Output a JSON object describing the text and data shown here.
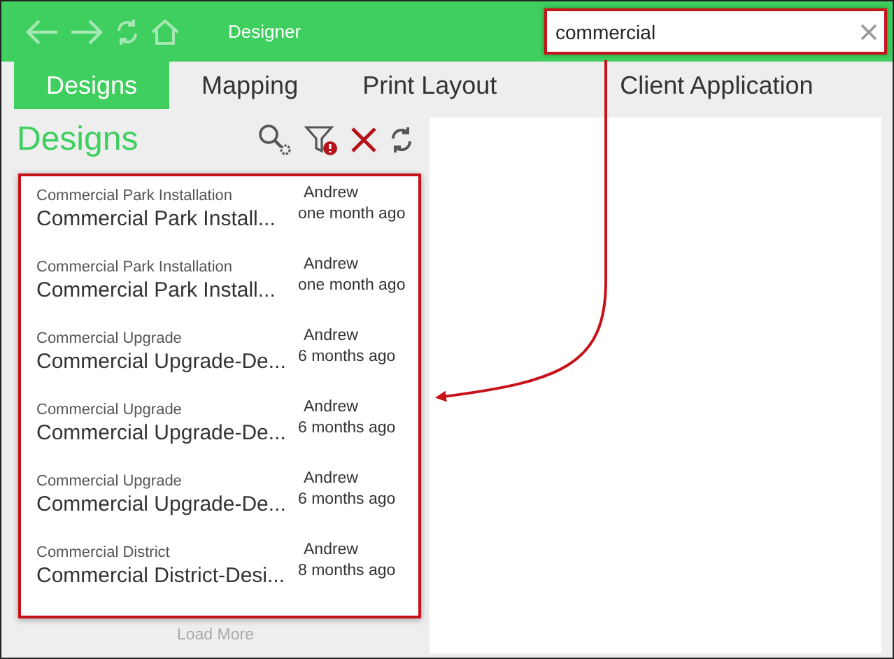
{
  "header": {
    "title": "Designer",
    "search": {
      "value": "commercial"
    }
  },
  "tabs": [
    {
      "label": "Designs",
      "selected": true
    },
    {
      "label": "Mapping",
      "selected": false
    },
    {
      "label": "Print Layout",
      "selected": false
    },
    {
      "label": "Client Application",
      "selected": false
    }
  ],
  "panel": {
    "title": "Designs",
    "designs": [
      {
        "category": "Commercial Park Installation",
        "name": "Commercial Park Install...",
        "author": "Andrew",
        "modified": "one month ago"
      },
      {
        "category": "Commercial Park Installation",
        "name": "Commercial Park Install...",
        "author": "Andrew",
        "modified": "one month ago"
      },
      {
        "category": "Commercial Upgrade",
        "name": "Commercial Upgrade-De...",
        "author": "Andrew",
        "modified": "6 months ago"
      },
      {
        "category": "Commercial Upgrade",
        "name": "Commercial Upgrade-De...",
        "author": "Andrew",
        "modified": "6 months ago"
      },
      {
        "category": "Commercial Upgrade",
        "name": "Commercial Upgrade-De...",
        "author": "Andrew",
        "modified": "6 months ago"
      },
      {
        "category": "Commercial District",
        "name": "Commercial District-Desi...",
        "author": "Andrew",
        "modified": "8 months ago"
      }
    ],
    "load_more": "Load More"
  }
}
